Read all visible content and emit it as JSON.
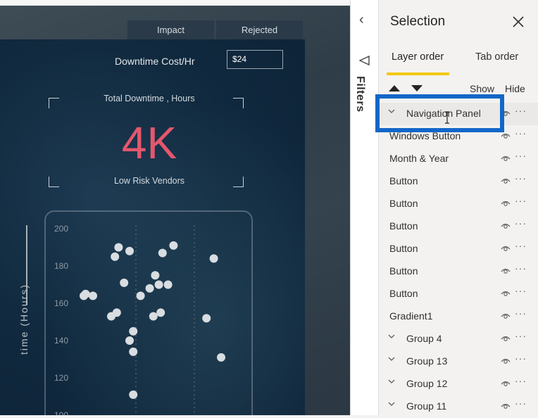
{
  "report": {
    "tabs": [
      {
        "label": "Impact"
      },
      {
        "label": "Rejected"
      }
    ],
    "cost_label": "Downtime Cost/Hr",
    "cost_value": "$24",
    "kpi": {
      "title": "Total Downtime , Hours",
      "value": "4K",
      "subtitle": "Low Risk Vendors"
    },
    "y_axis_title": "time (Hours)"
  },
  "chart_data": {
    "type": "scatter",
    "ylabel": "time (Hours)",
    "ylim": [
      100,
      205
    ],
    "yticks": [
      "200",
      "180",
      "160",
      "140",
      "120",
      "100"
    ],
    "points": [
      {
        "x": 0.34,
        "y": 190
      },
      {
        "x": 0.4,
        "y": 188
      },
      {
        "x": 0.32,
        "y": 185
      },
      {
        "x": 0.58,
        "y": 187
      },
      {
        "x": 0.64,
        "y": 191
      },
      {
        "x": 0.86,
        "y": 184
      },
      {
        "x": 0.37,
        "y": 171
      },
      {
        "x": 0.54,
        "y": 175
      },
      {
        "x": 0.56,
        "y": 170
      },
      {
        "x": 0.51,
        "y": 168
      },
      {
        "x": 0.61,
        "y": 170
      },
      {
        "x": 0.15,
        "y": 164
      },
      {
        "x": 0.16,
        "y": 165
      },
      {
        "x": 0.2,
        "y": 164
      },
      {
        "x": 0.46,
        "y": 164
      },
      {
        "x": 0.3,
        "y": 153
      },
      {
        "x": 0.33,
        "y": 155
      },
      {
        "x": 0.53,
        "y": 153
      },
      {
        "x": 0.57,
        "y": 155
      },
      {
        "x": 0.82,
        "y": 152
      },
      {
        "x": 0.42,
        "y": 145
      },
      {
        "x": 0.4,
        "y": 140
      },
      {
        "x": 0.42,
        "y": 134
      },
      {
        "x": 0.9,
        "y": 131
      },
      {
        "x": 0.42,
        "y": 111
      }
    ],
    "colors": {
      "point": "#d8dde1",
      "tick": "#8e9aa3",
      "grid": "#7f8c95"
    }
  },
  "filters": {
    "label": "Filters"
  },
  "selection": {
    "title": "Selection",
    "tabs": {
      "layer_order": "Layer order",
      "tab_order": "Tab order"
    },
    "show_label": "Show",
    "hide_label": "Hide",
    "items": [
      {
        "label": "Navigation Panel",
        "group": true
      },
      {
        "label": "Windows Button",
        "group": false
      },
      {
        "label": "Month & Year",
        "group": false
      },
      {
        "label": "Button",
        "group": false
      },
      {
        "label": "Button",
        "group": false
      },
      {
        "label": "Button",
        "group": false
      },
      {
        "label": "Button",
        "group": false
      },
      {
        "label": "Button",
        "group": false
      },
      {
        "label": "Button",
        "group": false
      },
      {
        "label": "Gradient1",
        "group": false
      },
      {
        "label": "Group 4",
        "group": true
      },
      {
        "label": "Group 13",
        "group": true
      },
      {
        "label": "Group 12",
        "group": true
      },
      {
        "label": "Group 11",
        "group": true
      }
    ],
    "accent": "#f2c811",
    "highlight": "#1267c8"
  }
}
